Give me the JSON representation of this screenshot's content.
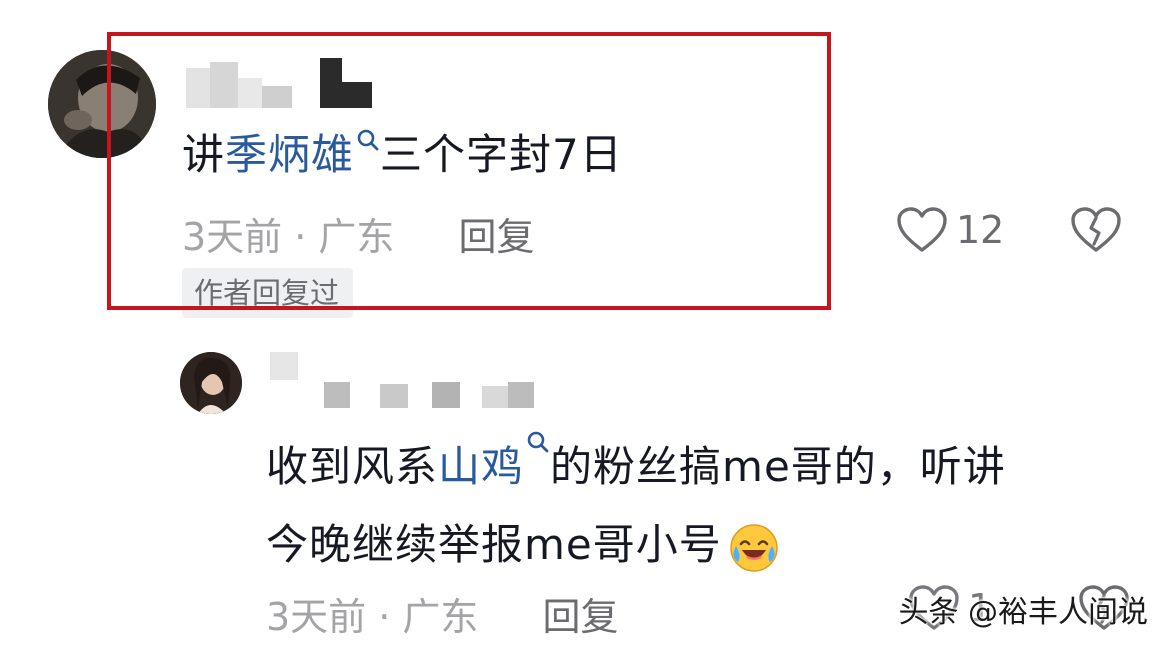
{
  "comments": [
    {
      "text_before": "讲",
      "link_text": "季炳雄",
      "text_after": "三个字封7日",
      "time_location": "3天前 · 广东",
      "reply_label": "回复",
      "like_count": "12",
      "badge": "作者回复过"
    },
    {
      "text_before": "收到风系",
      "link_text": "山鸡",
      "text_after_line1": "的粉丝搞me哥的，听讲",
      "text_line2": "今晚继续举报me哥小号",
      "time_location": "3天前 · 广东",
      "reply_label": "回复",
      "like_count": "1"
    }
  ],
  "watermark": "头条 @裕丰人间说",
  "colors": {
    "link": "#2a5a9e",
    "highlight_border": "#c4161c",
    "meta_text": "#a4a4a8",
    "badge_bg": "#eff0f2"
  },
  "icons": {
    "search": "search-icon",
    "like": "heart-outline-icon",
    "dislike": "broken-heart-icon",
    "emoji": "laughing-crying-emoji"
  }
}
